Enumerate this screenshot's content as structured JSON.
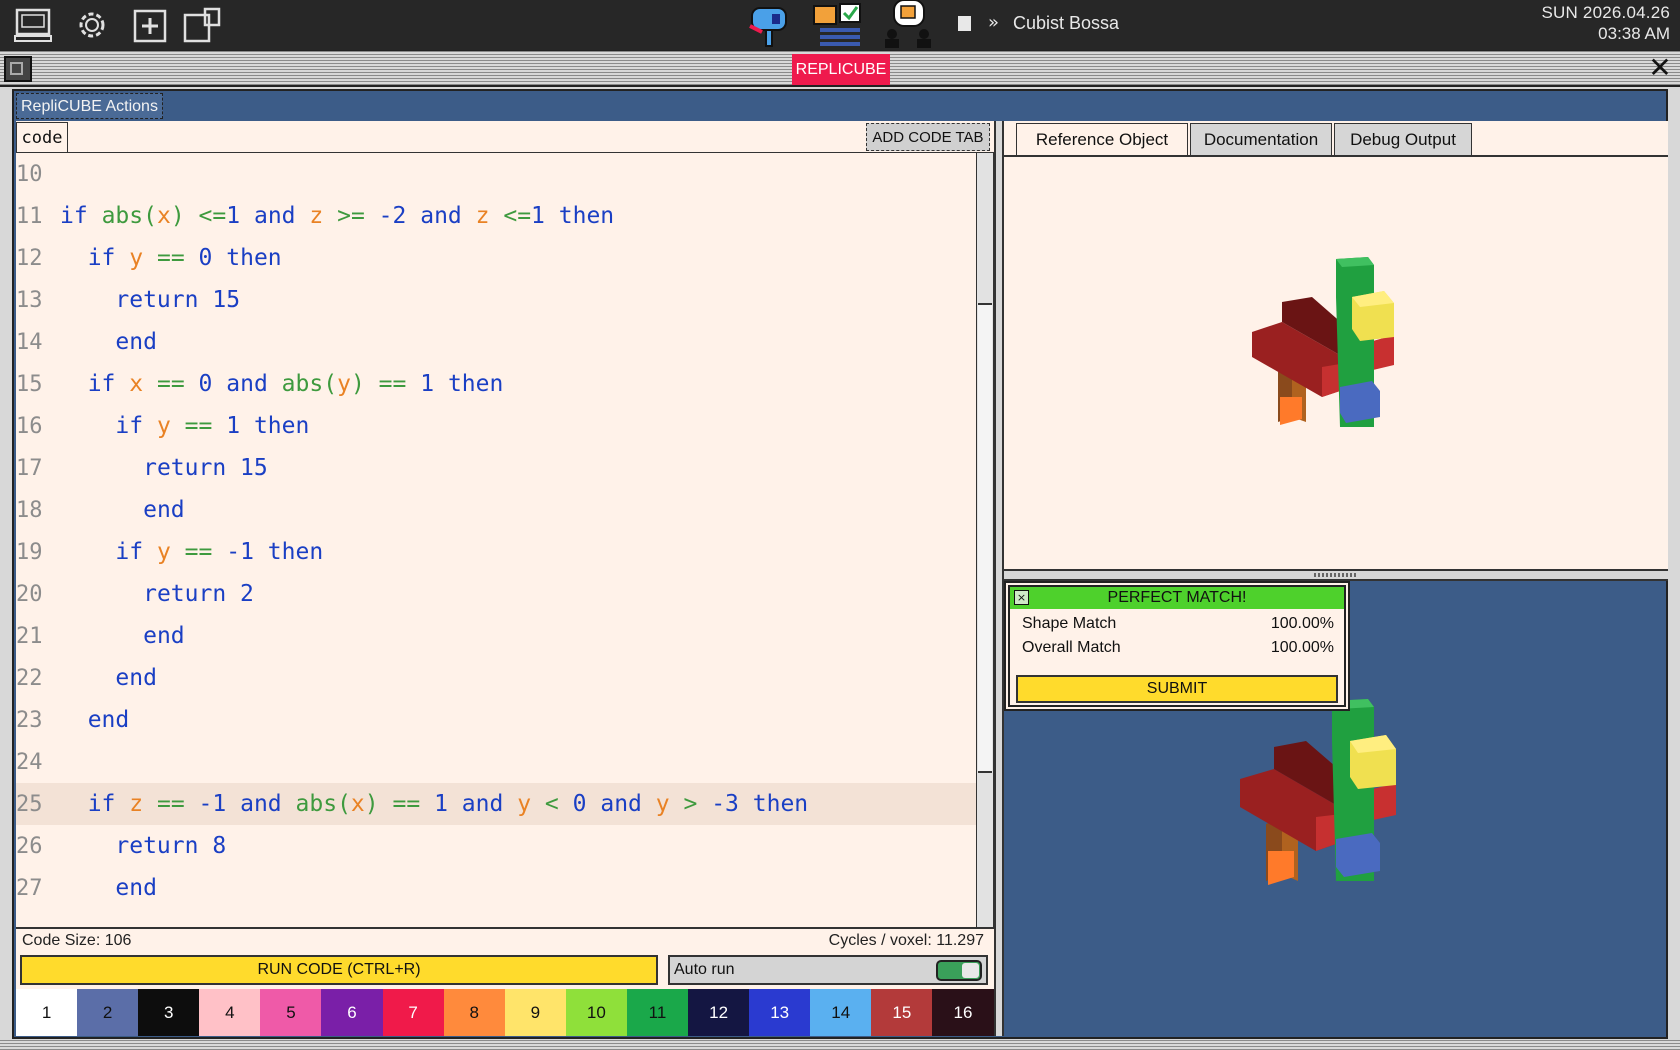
{
  "system_bar": {
    "date": "SUN 2026.04.26",
    "time": "03:38 AM",
    "now_playing": "Cubist Bossa",
    "icons": [
      "computer-icon",
      "gear-icon",
      "new-window-icon",
      "windows-icon",
      "mailbox-icon",
      "tasks-icon",
      "chat-icon"
    ]
  },
  "window": {
    "title": "REPLICUBE",
    "actions_tab": "RepliCUBE Actions"
  },
  "code_panel": {
    "tab": "code",
    "add_tab_label": "ADD CODE TAB",
    "code_size": "Code Size: 106",
    "cycles": "Cycles / voxel: 11.297",
    "run_label": "RUN CODE (CTRL+R)",
    "auto_run_label": "Auto run",
    "auto_run_on": true,
    "lines": [
      {
        "n": "10",
        "code": ""
      },
      {
        "n": "11",
        "code": "if abs(x) <=1 and z >= -2 and z <=1 then"
      },
      {
        "n": "12",
        "code": "  if y == 0 then"
      },
      {
        "n": "13",
        "code": "    return 15"
      },
      {
        "n": "14",
        "code": "    end"
      },
      {
        "n": "15",
        "code": "  if x == 0 and abs(y) == 1 then"
      },
      {
        "n": "16",
        "code": "    if y == 1 then"
      },
      {
        "n": "17",
        "code": "      return 15"
      },
      {
        "n": "18",
        "code": "      end"
      },
      {
        "n": "19",
        "code": "    if y == -1 then"
      },
      {
        "n": "20",
        "code": "      return 2"
      },
      {
        "n": "21",
        "code": "      end"
      },
      {
        "n": "22",
        "code": "    end"
      },
      {
        "n": "23",
        "code": "  end"
      },
      {
        "n": "24",
        "code": ""
      },
      {
        "n": "25",
        "code": "  if z == -1 and abs(x) == 1 and y < 0 and y > -3 then"
      },
      {
        "n": "26",
        "code": "    return 8"
      },
      {
        "n": "27",
        "code": "    end"
      }
    ],
    "current_line": "25"
  },
  "palette": [
    {
      "label": "1",
      "bg": "#ffffff",
      "fg": "#111111"
    },
    {
      "label": "2",
      "bg": "#5b6ea8",
      "fg": "#111111"
    },
    {
      "label": "3",
      "bg": "#0d0d0d",
      "fg": "#ffffff"
    },
    {
      "label": "4",
      "bg": "#ffc1c7",
      "fg": "#111111"
    },
    {
      "label": "5",
      "bg": "#ef5aa8",
      "fg": "#111111"
    },
    {
      "label": "6",
      "bg": "#7a1fa8",
      "fg": "#ffffff"
    },
    {
      "label": "7",
      "bg": "#f01a4a",
      "fg": "#ffffff"
    },
    {
      "label": "8",
      "bg": "#ff8a3c",
      "fg": "#111111"
    },
    {
      "label": "9",
      "bg": "#ffe46a",
      "fg": "#111111"
    },
    {
      "label": "10",
      "bg": "#8fe03a",
      "fg": "#111111"
    },
    {
      "label": "11",
      "bg": "#1aa84a",
      "fg": "#111111"
    },
    {
      "label": "12",
      "bg": "#141642",
      "fg": "#ffffff"
    },
    {
      "label": "13",
      "bg": "#2a3ad0",
      "fg": "#ffffff"
    },
    {
      "label": "14",
      "bg": "#5ab0f0",
      "fg": "#111111"
    },
    {
      "label": "15",
      "bg": "#b33a3a",
      "fg": "#ffffff"
    },
    {
      "label": "16",
      "bg": "#2a1018",
      "fg": "#ffffff"
    }
  ],
  "right_panel": {
    "tabs": [
      "Reference Object",
      "Documentation",
      "Debug Output"
    ],
    "active_tab": "Reference Object"
  },
  "match": {
    "title": "PERFECT MATCH!",
    "shape_label": "Shape Match",
    "shape_value": "100.00%",
    "overall_label": "Overall Match",
    "overall_value": "100.00%",
    "submit_label": "SUBMIT"
  }
}
